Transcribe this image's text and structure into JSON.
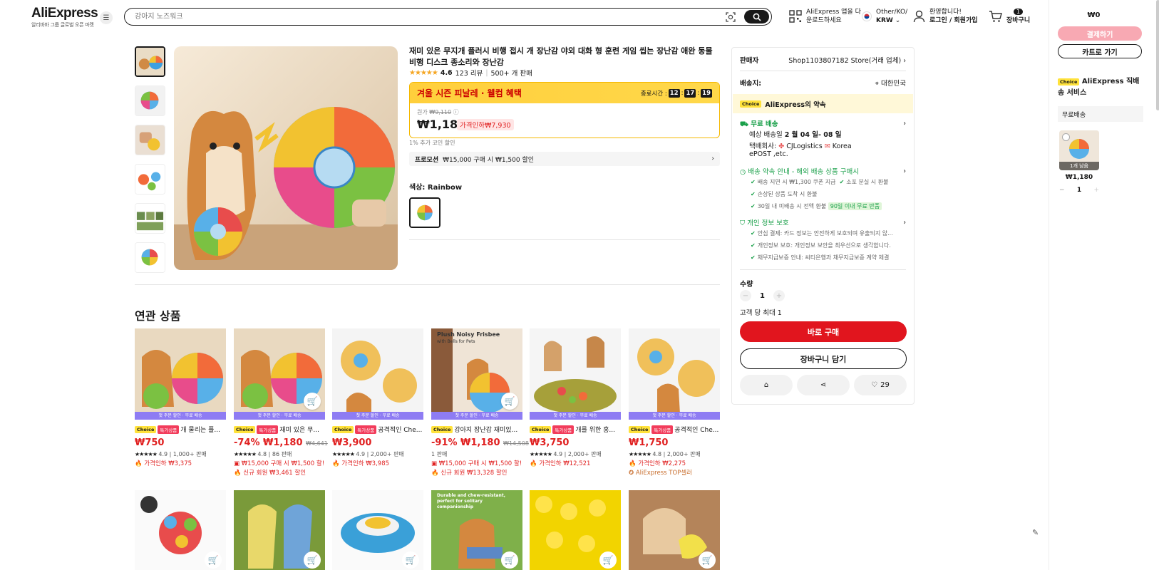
{
  "header": {
    "logo": "AliExpress",
    "logo_sub": "알리바바 그룹 글로벌 오픈 마켓",
    "search_placeholder": "강아지 노즈워크",
    "app_line1": "AliExpress 앱을 다",
    "app_line2": "운로드하세요",
    "locale_line1": "Other/KO/",
    "locale_line2": "KRW",
    "account_line1": "환영합니다!",
    "account_line2": "로그인 / 회원가입",
    "cart_count": "1",
    "cart_label": "장바구니"
  },
  "product": {
    "title": "재미 있은 무지개 플러시 비행 접시 개 장난감 야외 대화 형 훈련 게임 씹는 장난감 애완 동물 비행 디스크 종소리와 장난감",
    "rating": "4.6",
    "reviews": "123 리뷰",
    "sold": "500+ 개 판매",
    "promo_title": "겨울 시즌 피날레 · 웰컴 혜택",
    "ends_label": "종료시간 :",
    "timer": [
      "12",
      "17",
      "19"
    ],
    "orig_label": "원가",
    "orig_price": "₩9,110",
    "price": "₩1,180",
    "discount": "가격인하₩7,930",
    "coin_line": "1% 추가 코인 할인",
    "promotion_label": "프로모션",
    "promotion_text": "₩15,000 구매 시 ₩1,500 할인",
    "color_label": "색상:",
    "color_value": "Rainbow"
  },
  "related": {
    "title": "연관 상품",
    "banner": "첫 주문 할인 · 무료 배송",
    "cards": [
      {
        "title": "개 물리는 플...",
        "price": "₩750",
        "orig": "",
        "rating": "4.9",
        "sold": "1,000+ 판매",
        "line1": "가격인하 ₩3,375",
        "line2": "",
        "special": true,
        "cart": false
      },
      {
        "title": "재미 있은 무...",
        "price": "-74% ₩1,180",
        "orig": "₩4,641",
        "rating": "4.8",
        "sold": "86 판매",
        "line1": "₩15,000 구매 시 ₩1,500 할!",
        "line2": "신규 회원 ₩3,461 할인",
        "special": true,
        "cart": true
      },
      {
        "title": "공격적인 Che...",
        "price": "₩3,900",
        "orig": "",
        "rating": "4.9",
        "sold": "2,000+ 판매",
        "line1": "가격인하 ₩3,985",
        "line2": "",
        "special": true,
        "cart": false
      },
      {
        "title": "강아지 장난감 재미있...",
        "price": "-91% ₩1,180",
        "orig": "₩14,508",
        "rating": "",
        "sold": "1 판매",
        "line1": "₩15,000 구매 시 ₩1,500 할!",
        "line2": "신규 회원 ₩13,328 할인",
        "special": false,
        "cart": true
      },
      {
        "title": "개를 위한 홍...",
        "price": "₩3,750",
        "orig": "",
        "rating": "4.9",
        "sold": "2,000+ 판매",
        "line1": "가격인하 ₩12,521",
        "line2": "",
        "special": true,
        "cart": false
      },
      {
        "title": "공격적인 Che...",
        "price": "₩1,750",
        "orig": "",
        "rating": "4.8",
        "sold": "2,000+ 판매",
        "line1": "가격인하 ₩2,275",
        "line2": "AliExpress TOP셀러",
        "special": true,
        "cart": false
      }
    ],
    "card2_caption_title": "Plush Noisy Frisbee",
    "card2_caption_sub": "with Bells for Pets",
    "row2_caption": "Durable and chew-resistant, perfect for solitary companionship"
  },
  "choice_badge": "Choice",
  "special_badge": "특가상품",
  "panel": {
    "seller_label": "판매자",
    "seller_name": "Shop1103807182 Store(거래 업체)",
    "ship_to_label": "배송지:",
    "ship_to": "대한민국",
    "promise": "AliExpress의 약속",
    "free_ship": "무료 배송",
    "eta_prefix": "예상 배송일",
    "eta": "2 월 04 일- 08 일",
    "carrier_label": "택배회사:",
    "carrier": "CJLogistics",
    "carrier2": "Korea",
    "carrier3": "ePOST ,etc.",
    "guarantee_title": "배송 약속 안내 - 해외 배송 상품 구매시",
    "g1": "배송 지연 시 ₩1,300 쿠폰 지급",
    "g2": "소포 분실 시 환불",
    "g3": "손상된 상품 도착 시 환불",
    "g4": "30일 내 미배송 시 전액 환불",
    "g4_badge": "90일 이내 무료 반품",
    "privacy_title": "개인 정보 보호",
    "p1": "안심 결제: 카드 정보는 안전하게 보호되며 유출되지 않...",
    "p2": "개인정보 보호: 개인정보 보안을 최우선으로 생각합니다.",
    "p3": "채무지급보증 안내: 씨티은행과 채무지급보증 계약 체결",
    "qty_label": "수량",
    "qty": "1",
    "max_label": "고객 당 최대 1",
    "buy_now": "바로 구매",
    "add_cart": "장바구니 담기",
    "likes": "29"
  },
  "cart_panel": {
    "total": "₩0",
    "checkout": "결제하기",
    "go_cart": "카트로 가기",
    "service": "AliExpress 직배송 서비스",
    "free_ship": "무료배송",
    "left_badge": "1개 남음",
    "item_price": "₩1,180",
    "qty": "1"
  },
  "colors": {
    "accent_red": "#e1151e",
    "choice_yellow": "#ffe23b",
    "promo_yellow": "#ffcf3c",
    "banner_purple": "#8e7cf3",
    "green": "#1aa04a"
  }
}
